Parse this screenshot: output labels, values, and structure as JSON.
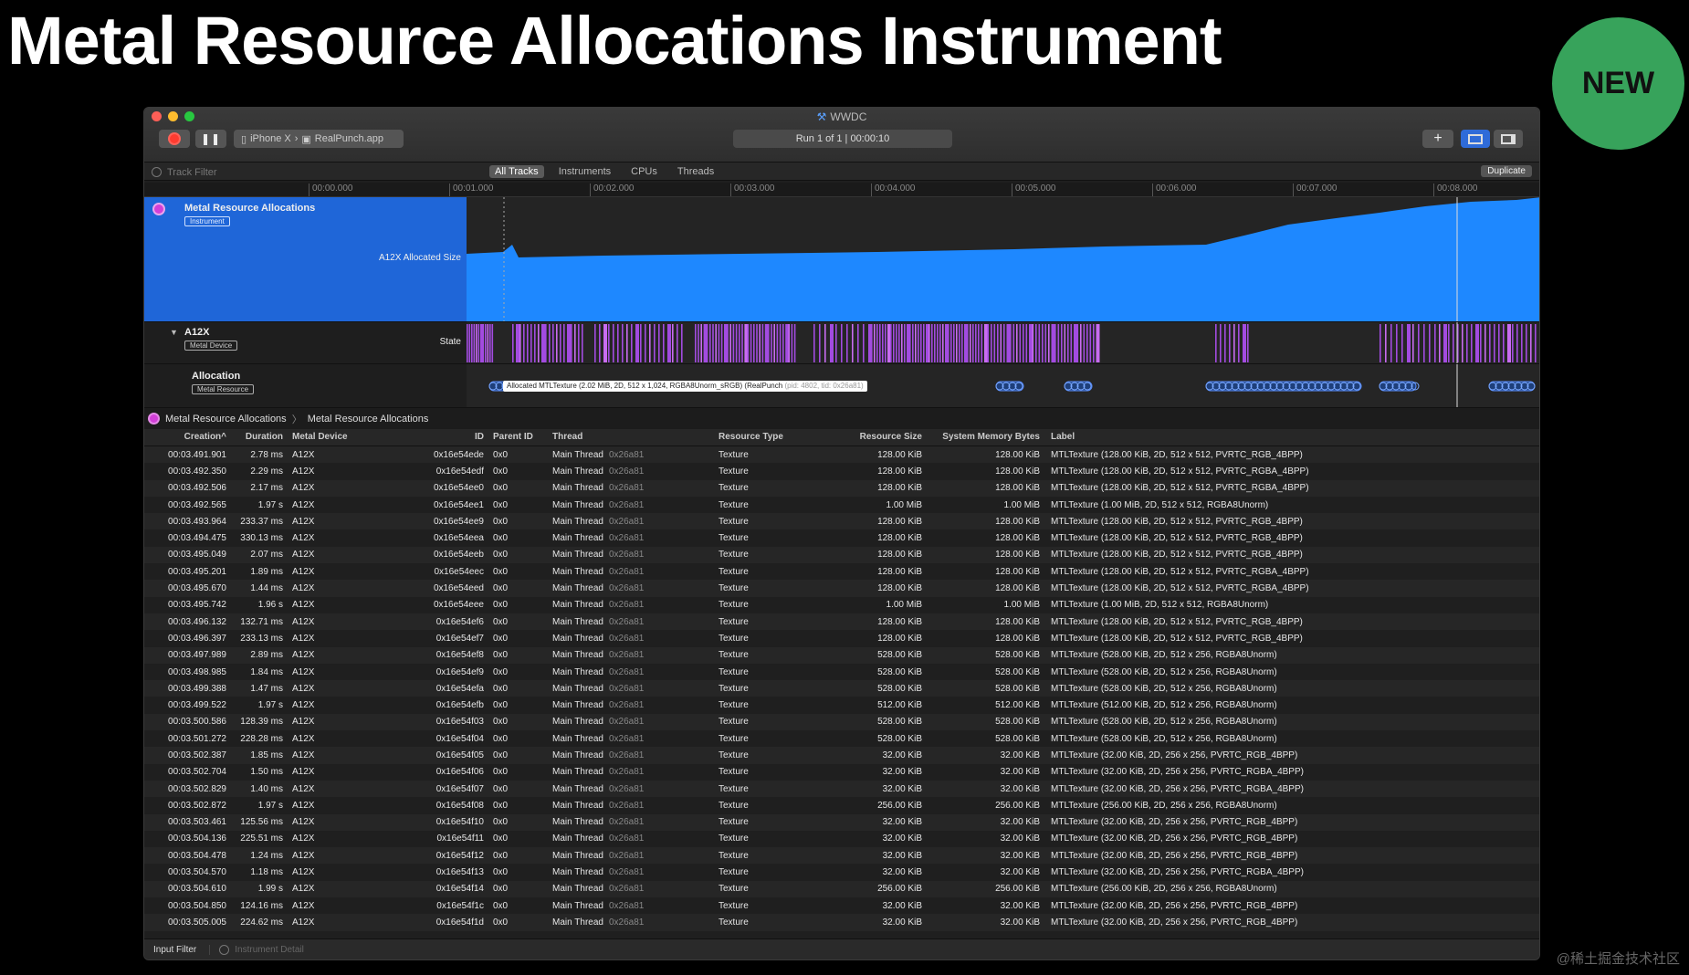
{
  "slide": {
    "title": "Metal Resource Allocations Instrument",
    "badge": "NEW",
    "watermark": "@稀土掘金技术社区"
  },
  "window": {
    "title": "WWDC",
    "target_device": "iPhone X",
    "target_app": "RealPunch.app",
    "run_status": "Run 1 of 1  |  00:00:10",
    "track_filter_placeholder": "Track Filter",
    "tabs": [
      "All Tracks",
      "Instruments",
      "CPUs",
      "Threads"
    ],
    "active_tab": "All Tracks",
    "duplicate_label": "Duplicate",
    "ruler_ticks": [
      "00:00.000",
      "00:01.000",
      "00:02.000",
      "00:03.000",
      "00:04.000",
      "00:05.000",
      "00:06.000",
      "00:07.000",
      "00:08.000"
    ]
  },
  "tracks": {
    "instrument": {
      "name": "Metal Resource Allocations",
      "tag": "Instrument",
      "lane": "A12X Allocated Size"
    },
    "device": {
      "name": "A12X",
      "tag": "Metal Device",
      "lane": "State"
    },
    "allocation": {
      "name": "Allocation",
      "tag": "Metal Resource",
      "hover_label": "Allocated MTLTexture (2.02 MiB, 2D, 512 x 1,024, RGBA8Unorm_sRGB) (RealPunch",
      "hover_pid": "(pid: 4802, tid: 0x26a81)"
    }
  },
  "breadcrumb": [
    "Metal Resource Allocations",
    "Metal Resource Allocations"
  ],
  "table": {
    "columns": [
      "Creation^",
      "Duration",
      "Metal Device",
      "ID",
      "Parent ID",
      "Thread",
      "Resource Type",
      "Resource Size",
      "System Memory Bytes",
      "Label"
    ],
    "rows": [
      [
        "00:03.491.901",
        "2.78 ms",
        "A12X",
        "0x16e54ede",
        "0x0",
        "Main Thread",
        "0x26a81",
        "Texture",
        "128.00 KiB",
        "128.00 KiB",
        "MTLTexture (128.00 KiB, 2D, 512 x 512, PVRTC_RGB_4BPP)"
      ],
      [
        "00:03.492.350",
        "2.29 ms",
        "A12X",
        "0x16e54edf",
        "0x0",
        "Main Thread",
        "0x26a81",
        "Texture",
        "128.00 KiB",
        "128.00 KiB",
        "MTLTexture (128.00 KiB, 2D, 512 x 512, PVRTC_RGBA_4BPP)"
      ],
      [
        "00:03.492.506",
        "2.17 ms",
        "A12X",
        "0x16e54ee0",
        "0x0",
        "Main Thread",
        "0x26a81",
        "Texture",
        "128.00 KiB",
        "128.00 KiB",
        "MTLTexture (128.00 KiB, 2D, 512 x 512, PVRTC_RGBA_4BPP)"
      ],
      [
        "00:03.492.565",
        "1.97 s",
        "A12X",
        "0x16e54ee1",
        "0x0",
        "Main Thread",
        "0x26a81",
        "Texture",
        "1.00 MiB",
        "1.00 MiB",
        "MTLTexture (1.00 MiB, 2D, 512 x 512, RGBA8Unorm)"
      ],
      [
        "00:03.493.964",
        "233.37 ms",
        "A12X",
        "0x16e54ee9",
        "0x0",
        "Main Thread",
        "0x26a81",
        "Texture",
        "128.00 KiB",
        "128.00 KiB",
        "MTLTexture (128.00 KiB, 2D, 512 x 512, PVRTC_RGB_4BPP)"
      ],
      [
        "00:03.494.475",
        "330.13 ms",
        "A12X",
        "0x16e54eea",
        "0x0",
        "Main Thread",
        "0x26a81",
        "Texture",
        "128.00 KiB",
        "128.00 KiB",
        "MTLTexture (128.00 KiB, 2D, 512 x 512, PVRTC_RGB_4BPP)"
      ],
      [
        "00:03.495.049",
        "2.07 ms",
        "A12X",
        "0x16e54eeb",
        "0x0",
        "Main Thread",
        "0x26a81",
        "Texture",
        "128.00 KiB",
        "128.00 KiB",
        "MTLTexture (128.00 KiB, 2D, 512 x 512, PVRTC_RGB_4BPP)"
      ],
      [
        "00:03.495.201",
        "1.89 ms",
        "A12X",
        "0x16e54eec",
        "0x0",
        "Main Thread",
        "0x26a81",
        "Texture",
        "128.00 KiB",
        "128.00 KiB",
        "MTLTexture (128.00 KiB, 2D, 512 x 512, PVRTC_RGBA_4BPP)"
      ],
      [
        "00:03.495.670",
        "1.44 ms",
        "A12X",
        "0x16e54eed",
        "0x0",
        "Main Thread",
        "0x26a81",
        "Texture",
        "128.00 KiB",
        "128.00 KiB",
        "MTLTexture (128.00 KiB, 2D, 512 x 512, PVRTC_RGBA_4BPP)"
      ],
      [
        "00:03.495.742",
        "1.96 s",
        "A12X",
        "0x16e54eee",
        "0x0",
        "Main Thread",
        "0x26a81",
        "Texture",
        "1.00 MiB",
        "1.00 MiB",
        "MTLTexture (1.00 MiB, 2D, 512 x 512, RGBA8Unorm)"
      ],
      [
        "00:03.496.132",
        "132.71 ms",
        "A12X",
        "0x16e54ef6",
        "0x0",
        "Main Thread",
        "0x26a81",
        "Texture",
        "128.00 KiB",
        "128.00 KiB",
        "MTLTexture (128.00 KiB, 2D, 512 x 512, PVRTC_RGB_4BPP)"
      ],
      [
        "00:03.496.397",
        "233.13 ms",
        "A12X",
        "0x16e54ef7",
        "0x0",
        "Main Thread",
        "0x26a81",
        "Texture",
        "128.00 KiB",
        "128.00 KiB",
        "MTLTexture (128.00 KiB, 2D, 512 x 512, PVRTC_RGB_4BPP)"
      ],
      [
        "00:03.497.989",
        "2.89 ms",
        "A12X",
        "0x16e54ef8",
        "0x0",
        "Main Thread",
        "0x26a81",
        "Texture",
        "528.00 KiB",
        "528.00 KiB",
        "MTLTexture (528.00 KiB, 2D, 512 x 256, RGBA8Unorm)"
      ],
      [
        "00:03.498.985",
        "1.84 ms",
        "A12X",
        "0x16e54ef9",
        "0x0",
        "Main Thread",
        "0x26a81",
        "Texture",
        "528.00 KiB",
        "528.00 KiB",
        "MTLTexture (528.00 KiB, 2D, 512 x 256, RGBA8Unorm)"
      ],
      [
        "00:03.499.388",
        "1.47 ms",
        "A12X",
        "0x16e54efa",
        "0x0",
        "Main Thread",
        "0x26a81",
        "Texture",
        "528.00 KiB",
        "528.00 KiB",
        "MTLTexture (528.00 KiB, 2D, 512 x 256, RGBA8Unorm)"
      ],
      [
        "00:03.499.522",
        "1.97 s",
        "A12X",
        "0x16e54efb",
        "0x0",
        "Main Thread",
        "0x26a81",
        "Texture",
        "512.00 KiB",
        "512.00 KiB",
        "MTLTexture (512.00 KiB, 2D, 512 x 256, RGBA8Unorm)"
      ],
      [
        "00:03.500.586",
        "128.39 ms",
        "A12X",
        "0x16e54f03",
        "0x0",
        "Main Thread",
        "0x26a81",
        "Texture",
        "528.00 KiB",
        "528.00 KiB",
        "MTLTexture (528.00 KiB, 2D, 512 x 256, RGBA8Unorm)"
      ],
      [
        "00:03.501.272",
        "228.28 ms",
        "A12X",
        "0x16e54f04",
        "0x0",
        "Main Thread",
        "0x26a81",
        "Texture",
        "528.00 KiB",
        "528.00 KiB",
        "MTLTexture (528.00 KiB, 2D, 512 x 256, RGBA8Unorm)"
      ],
      [
        "00:03.502.387",
        "1.85 ms",
        "A12X",
        "0x16e54f05",
        "0x0",
        "Main Thread",
        "0x26a81",
        "Texture",
        "32.00 KiB",
        "32.00 KiB",
        "MTLTexture (32.00 KiB, 2D, 256 x 256, PVRTC_RGB_4BPP)"
      ],
      [
        "00:03.502.704",
        "1.50 ms",
        "A12X",
        "0x16e54f06",
        "0x0",
        "Main Thread",
        "0x26a81",
        "Texture",
        "32.00 KiB",
        "32.00 KiB",
        "MTLTexture (32.00 KiB, 2D, 256 x 256, PVRTC_RGBA_4BPP)"
      ],
      [
        "00:03.502.829",
        "1.40 ms",
        "A12X",
        "0x16e54f07",
        "0x0",
        "Main Thread",
        "0x26a81",
        "Texture",
        "32.00 KiB",
        "32.00 KiB",
        "MTLTexture (32.00 KiB, 2D, 256 x 256, PVRTC_RGBA_4BPP)"
      ],
      [
        "00:03.502.872",
        "1.97 s",
        "A12X",
        "0x16e54f08",
        "0x0",
        "Main Thread",
        "0x26a81",
        "Texture",
        "256.00 KiB",
        "256.00 KiB",
        "MTLTexture (256.00 KiB, 2D, 256 x 256, RGBA8Unorm)"
      ],
      [
        "00:03.503.461",
        "125.56 ms",
        "A12X",
        "0x16e54f10",
        "0x0",
        "Main Thread",
        "0x26a81",
        "Texture",
        "32.00 KiB",
        "32.00 KiB",
        "MTLTexture (32.00 KiB, 2D, 256 x 256, PVRTC_RGB_4BPP)"
      ],
      [
        "00:03.504.136",
        "225.51 ms",
        "A12X",
        "0x16e54f11",
        "0x0",
        "Main Thread",
        "0x26a81",
        "Texture",
        "32.00 KiB",
        "32.00 KiB",
        "MTLTexture (32.00 KiB, 2D, 256 x 256, PVRTC_RGB_4BPP)"
      ],
      [
        "00:03.504.478",
        "1.24 ms",
        "A12X",
        "0x16e54f12",
        "0x0",
        "Main Thread",
        "0x26a81",
        "Texture",
        "32.00 KiB",
        "32.00 KiB",
        "MTLTexture (32.00 KiB, 2D, 256 x 256, PVRTC_RGB_4BPP)"
      ],
      [
        "00:03.504.570",
        "1.18 ms",
        "A12X",
        "0x16e54f13",
        "0x0",
        "Main Thread",
        "0x26a81",
        "Texture",
        "32.00 KiB",
        "32.00 KiB",
        "MTLTexture (32.00 KiB, 2D, 256 x 256, PVRTC_RGBA_4BPP)"
      ],
      [
        "00:03.504.610",
        "1.99 s",
        "A12X",
        "0x16e54f14",
        "0x0",
        "Main Thread",
        "0x26a81",
        "Texture",
        "256.00 KiB",
        "256.00 KiB",
        "MTLTexture (256.00 KiB, 2D, 256 x 256, RGBA8Unorm)"
      ],
      [
        "00:03.504.850",
        "124.16 ms",
        "A12X",
        "0x16e54f1c",
        "0x0",
        "Main Thread",
        "0x26a81",
        "Texture",
        "32.00 KiB",
        "32.00 KiB",
        "MTLTexture (32.00 KiB, 2D, 256 x 256, PVRTC_RGB_4BPP)"
      ],
      [
        "00:03.505.005",
        "224.62 ms",
        "A12X",
        "0x16e54f1d",
        "0x0",
        "Main Thread",
        "0x26a81",
        "Texture",
        "32.00 KiB",
        "32.00 KiB",
        "MTLTexture (32.00 KiB, 2D, 256 x 256, PVRTC_RGB_4BPP)"
      ]
    ]
  },
  "statusbar": {
    "input_filter": "Input Filter",
    "detail_placeholder": "Instrument Detail"
  },
  "colors": {
    "accent_blue": "#1f66d8",
    "graph_blue": "#1e88ff",
    "state_purple": "#a24be0",
    "badge_green": "#37a35b"
  },
  "icons": [
    "record-icon",
    "pause-icon",
    "app-icon",
    "plus-icon",
    "layout-icon",
    "sidebar-icon",
    "filter-icon",
    "instrument-icon"
  ]
}
